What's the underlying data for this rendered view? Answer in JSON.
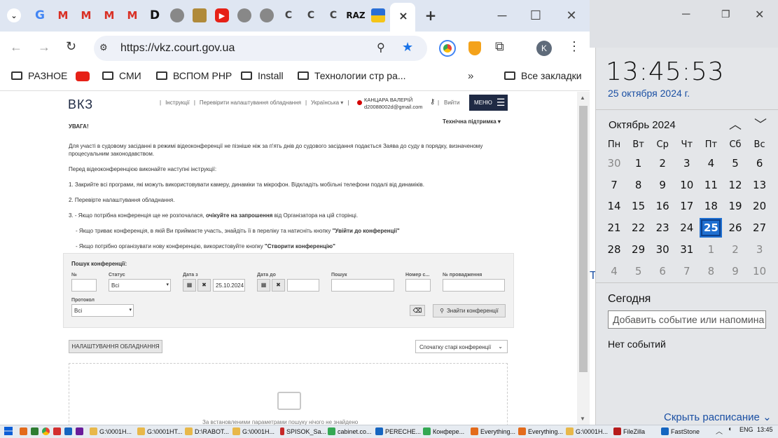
{
  "browser": {
    "tabs": [
      "G",
      "M",
      "M",
      "M",
      "M",
      "D",
      "",
      "",
      "",
      "",
      "C",
      "C",
      "C",
      "RAZ",
      "",
      "×",
      "+"
    ],
    "url": "https://vkz.court.gov.ua",
    "profile_letter": "K",
    "bookmarks": [
      "РАЗНОЕ",
      "СМИ",
      "ВСПОМ PHP",
      "Install",
      "Технологии стр ра...",
      "Все закладки"
    ]
  },
  "site": {
    "logo": "ВКЗ",
    "nav": [
      "Інструкції",
      "Перевірити налаштування обладнання",
      "Українська ▾"
    ],
    "user_name": "КАНЦАРА ВАЛЕРІЙ",
    "user_email": "d20088002d@gmail.com",
    "logout": "Вийти",
    "menu": "МЕНЮ",
    "support": "Технічна підтримка ▾",
    "warning_title": "УВАГА!",
    "p1": "Для участі в судовому засіданні в режимі відеоконференції не пізніше ніж за п'ять днів до судового засідання подається Заява до суду в порядку, визначеному процесуальним законодавством.",
    "p2": "Перед відеоконференцією виконайте наступні інструкції:",
    "p3": "1. Закрийте всі програми, які можуть використовувати камеру, динаміки та мікрофон. Відкладіть мобільні телефони подалі від динаміків.",
    "p4": "2. Перевірте налаштування обладнання.",
    "p5a": "3.  - Якщо потрібна конференція ще не розпочалася, ",
    "p5b": "очікуйте на запрошення",
    "p5c": " від Організатора на цій сторінці.",
    "p6a": "- Якщо триває конференція, в якій Ви приймаєте участь, знайдіть її в переліку та натисніть кнопку ",
    "p6b": "\"Увійти до конференції\"",
    "p7a": "- Якщо потрібно організувати нову конференцію, використовуйте кнопку ",
    "p7b": "\"Створити конференцію\"",
    "search": {
      "title": "Пошук конференції:",
      "labels": [
        "№",
        "Статус",
        "Дата з",
        "Дата до",
        "Пошук",
        "Номер с...",
        "№ провадження",
        "Протокол"
      ],
      "status_value": "Всі",
      "date_from": "25.10.2024",
      "protocol_value": "Всі",
      "find_button": "Знайти конференції"
    },
    "settings_button": "НАЛАШТУВАННЯ ОБЛАДНАННЯ",
    "sort_value": "Спочатку старі конференції",
    "empty_text": "За встановленими параметрами пошуку нічого не знайдено"
  },
  "calendar": {
    "time": "13:45:53",
    "date": "25 октября 2024 г.",
    "month": "Октябрь 2024",
    "weekdays": [
      "Пн",
      "Вт",
      "Ср",
      "Чт",
      "Пт",
      "Сб",
      "Вс"
    ],
    "days": [
      30,
      1,
      2,
      3,
      4,
      5,
      6,
      7,
      8,
      9,
      10,
      11,
      12,
      13,
      14,
      15,
      16,
      17,
      18,
      19,
      20,
      21,
      22,
      23,
      24,
      25,
      26,
      27,
      28,
      29,
      30,
      31,
      1,
      2,
      3,
      4,
      5,
      6,
      7,
      8,
      9,
      10
    ],
    "today": "Сегодня",
    "add_event_placeholder": "Добавить событие или напомина",
    "no_events": "Нет событий",
    "hide_schedule": "Скрыть расписание"
  },
  "taskbar": {
    "items": [
      "G:\\0001H...",
      "G:\\0001HT...",
      "D:\\RABOT...",
      "G:\\0001H...",
      "SPISOK_Sa...",
      "cabinet.co...",
      "PERECHE...",
      "Конфере...",
      "Everything...",
      "Everything...",
      "G:\\0001H...",
      "FileZilla",
      "FastStone"
    ],
    "lang": "ENG",
    "clock": "13:45"
  },
  "colors": {
    "accent": "#1a73e8",
    "menu_bg": "#1f2a44",
    "today_bg": "#1f6fd0",
    "link": "#1a4fa3"
  }
}
